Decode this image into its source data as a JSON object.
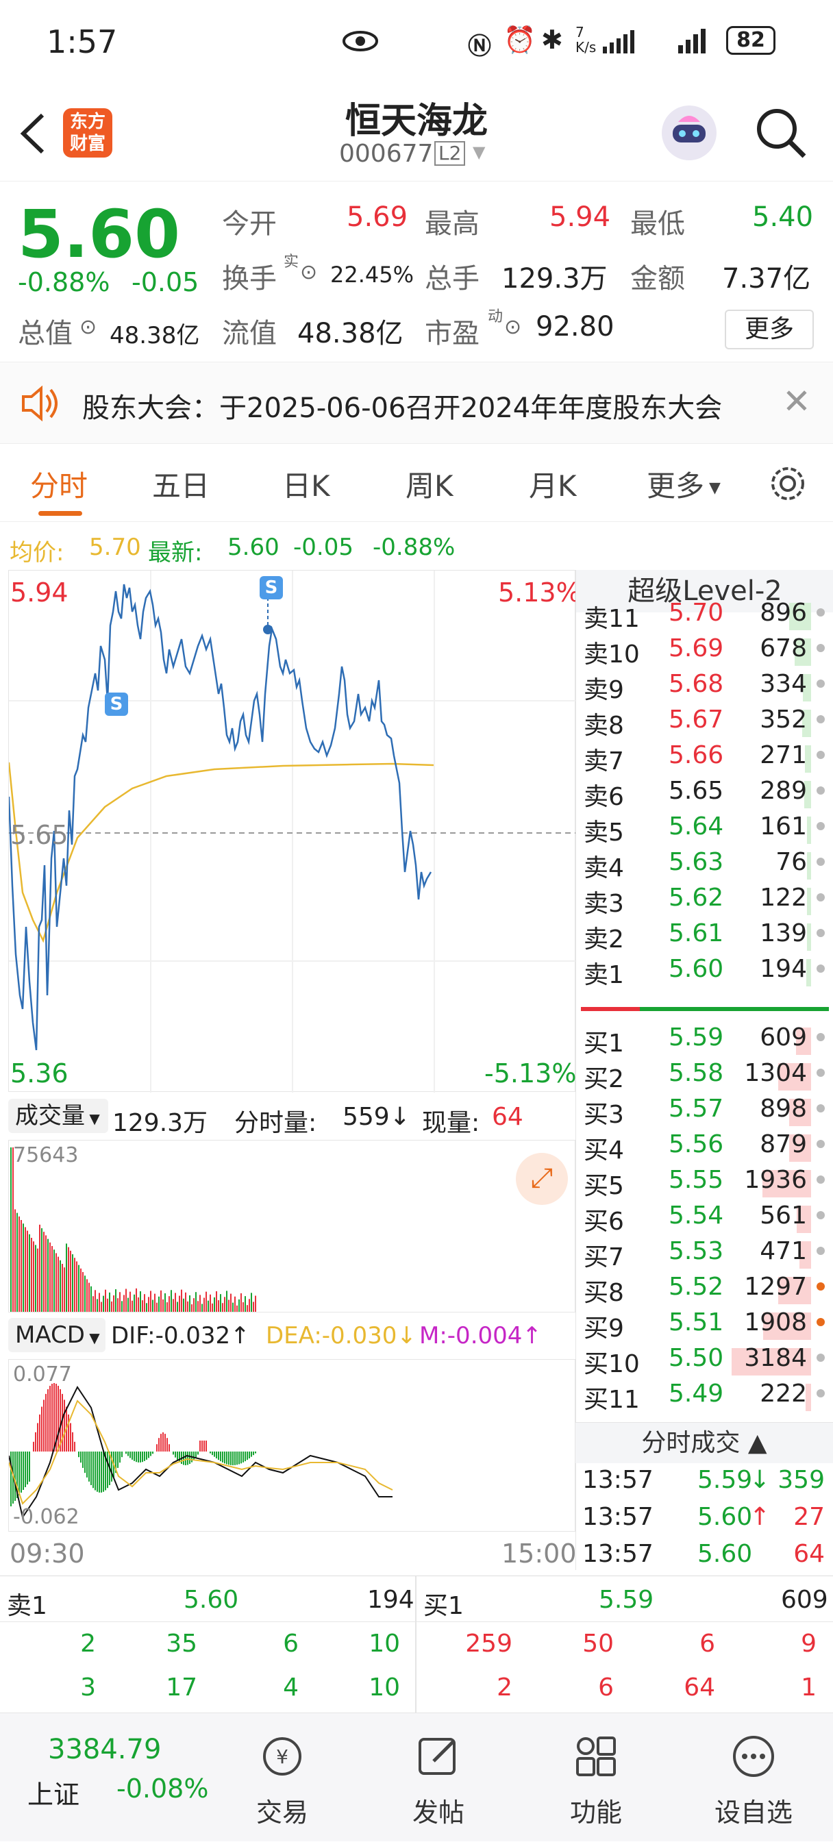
{
  "status_bar": {
    "time": "1:57",
    "net_speed": "7\nK/s",
    "battery": "82"
  },
  "header": {
    "title": "恒天海龙",
    "code": "000677",
    "level_badge": "L2",
    "logo_text": "东方\n财富"
  },
  "quote": {
    "price": "5.60",
    "change_pct": "-0.88%",
    "change": "-0.05",
    "open_label": "今开",
    "open": "5.69",
    "high_label": "最高",
    "high": "5.94",
    "low_label": "最低",
    "low": "5.40",
    "turnover_label": "换手",
    "turnover_sup": "实",
    "turnover": "22.45%",
    "volume_label": "总手",
    "volume": "129.3万",
    "amount_label": "金额",
    "amount": "7.37亿",
    "mktcap_label": "总值",
    "mktcap": "48.38亿",
    "float_label": "流值",
    "float_cap": "48.38亿",
    "pe_label": "市盈",
    "pe_sup": "动",
    "pe": "92.80",
    "more_button": "更多"
  },
  "notice": {
    "text": "股东大会：于2025-06-06召开2024年年度股东大会"
  },
  "tabs": [
    "分时",
    "五日",
    "日K",
    "周K",
    "月K",
    "更多"
  ],
  "avg_line": {
    "avg_label": "均价:",
    "avg": "5.70",
    "latest_label": "最新:",
    "latest": "5.60",
    "chg": "-0.05",
    "pct": "-0.88%"
  },
  "intraday": {
    "y_high": "5.94",
    "y_low": "5.36",
    "y_mid": "5.65",
    "pct_high": "5.13%",
    "pct_low": "-5.13%",
    "marker_s": "S"
  },
  "volume_panel": {
    "dropdown": "成交量",
    "total": "129.3万",
    "tick_label": "分时量:",
    "tick": "559",
    "now_label": "现量:",
    "now": "64",
    "max": "75643"
  },
  "macd_panel": {
    "dropdown": "MACD",
    "dif": "DIF:-0.032",
    "dea": "DEA:-0.030",
    "m": "M:-0.004",
    "top": "0.077",
    "bottom": "-0.062"
  },
  "time_axis": {
    "start": "09:30",
    "end": "15:00"
  },
  "orderbook": {
    "title": "超级Level-2",
    "asks": [
      {
        "name": "卖11",
        "price": "5.70",
        "vol": "896",
        "bar": 0.28
      },
      {
        "name": "卖10",
        "price": "5.69",
        "vol": "678",
        "bar": 0.21
      },
      {
        "name": "卖9",
        "price": "5.68",
        "vol": "334",
        "bar": 0.1
      },
      {
        "name": "卖8",
        "price": "5.67",
        "vol": "352",
        "bar": 0.11
      },
      {
        "name": "卖7",
        "price": "5.66",
        "vol": "271",
        "bar": 0.08
      },
      {
        "name": "卖6",
        "price": "5.65",
        "vol": "289",
        "bar": 0.09
      },
      {
        "name": "卖5",
        "price": "5.64",
        "vol": "161",
        "bar": 0.05
      },
      {
        "name": "卖4",
        "price": "5.63",
        "vol": "76",
        "bar": 0.02
      },
      {
        "name": "卖3",
        "price": "5.62",
        "vol": "122",
        "bar": 0.04
      },
      {
        "name": "卖2",
        "price": "5.61",
        "vol": "139",
        "bar": 0.04
      },
      {
        "name": "卖1",
        "price": "5.60",
        "vol": "194",
        "bar": 0.06
      }
    ],
    "bids": [
      {
        "name": "买1",
        "price": "5.59",
        "vol": "609",
        "bar": 0.19
      },
      {
        "name": "买2",
        "price": "5.58",
        "vol": "1304",
        "bar": 0.41
      },
      {
        "name": "买3",
        "price": "5.57",
        "vol": "898",
        "bar": 0.28
      },
      {
        "name": "买4",
        "price": "5.56",
        "vol": "879",
        "bar": 0.28
      },
      {
        "name": "买5",
        "price": "5.55",
        "vol": "1936",
        "bar": 0.61
      },
      {
        "name": "买6",
        "price": "5.54",
        "vol": "561",
        "bar": 0.18
      },
      {
        "name": "买7",
        "price": "5.53",
        "vol": "471",
        "bar": 0.15
      },
      {
        "name": "买8",
        "price": "5.52",
        "vol": "1297",
        "bar": 0.41
      },
      {
        "name": "买9",
        "price": "5.51",
        "vol": "1908",
        "bar": 0.6
      },
      {
        "name": "买10",
        "price": "5.50",
        "vol": "3184",
        "bar": 1.0
      },
      {
        "name": "买11",
        "price": "5.49",
        "vol": "222",
        "bar": 0.07
      }
    ],
    "trades_title": "分时成交",
    "trades": [
      {
        "time": "13:57",
        "price": "5.59",
        "arrow": "↓",
        "vol": "359"
      },
      {
        "time": "13:57",
        "price": "5.60",
        "arrow": "↑",
        "vol": "27"
      },
      {
        "time": "13:57",
        "price": "5.60",
        "arrow": "",
        "vol": "64"
      }
    ]
  },
  "bottom_quote": {
    "ask_label": "卖1",
    "ask_price": "5.60",
    "ask_vol": "194",
    "bid_label": "买1",
    "bid_price": "5.59",
    "bid_vol": "609",
    "ask_queue": [
      [
        "2",
        "35",
        "6",
        "10"
      ],
      [
        "3",
        "17",
        "4",
        "10"
      ]
    ],
    "bid_queue": [
      [
        "259",
        "50",
        "6",
        "9"
      ],
      [
        "2",
        "6",
        "64",
        "1"
      ]
    ]
  },
  "bottom_nav": {
    "index_value": "3384.79",
    "index_name": "上证",
    "index_pct": "-0.08%",
    "items": [
      "交易",
      "发帖",
      "功能",
      "设自选"
    ]
  },
  "colors": {
    "red": "#e8303a",
    "green": "#17a332",
    "accent": "#e86a1a",
    "price_line": "#2e6db4",
    "avg_line": "#e8b830"
  }
}
